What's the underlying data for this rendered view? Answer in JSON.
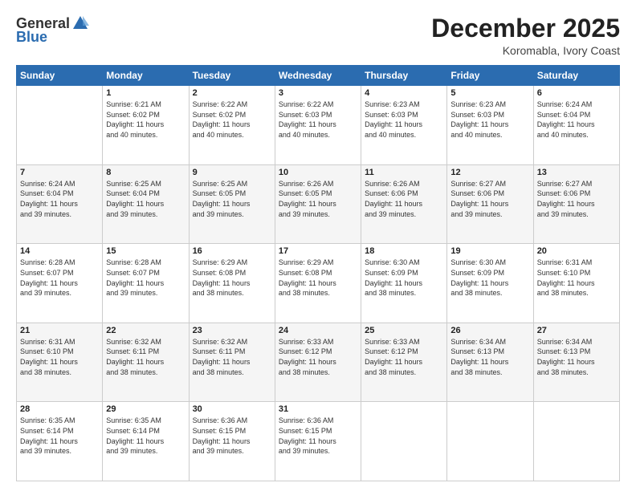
{
  "header": {
    "logo_general": "General",
    "logo_blue": "Blue",
    "month": "December 2025",
    "location": "Koromabla, Ivory Coast"
  },
  "days_of_week": [
    "Sunday",
    "Monday",
    "Tuesday",
    "Wednesday",
    "Thursday",
    "Friday",
    "Saturday"
  ],
  "weeks": [
    [
      {
        "day": "",
        "info": ""
      },
      {
        "day": "1",
        "info": "Sunrise: 6:21 AM\nSunset: 6:02 PM\nDaylight: 11 hours\nand 40 minutes."
      },
      {
        "day": "2",
        "info": "Sunrise: 6:22 AM\nSunset: 6:02 PM\nDaylight: 11 hours\nand 40 minutes."
      },
      {
        "day": "3",
        "info": "Sunrise: 6:22 AM\nSunset: 6:03 PM\nDaylight: 11 hours\nand 40 minutes."
      },
      {
        "day": "4",
        "info": "Sunrise: 6:23 AM\nSunset: 6:03 PM\nDaylight: 11 hours\nand 40 minutes."
      },
      {
        "day": "5",
        "info": "Sunrise: 6:23 AM\nSunset: 6:03 PM\nDaylight: 11 hours\nand 40 minutes."
      },
      {
        "day": "6",
        "info": "Sunrise: 6:24 AM\nSunset: 6:04 PM\nDaylight: 11 hours\nand 40 minutes."
      }
    ],
    [
      {
        "day": "7",
        "info": "Sunrise: 6:24 AM\nSunset: 6:04 PM\nDaylight: 11 hours\nand 39 minutes."
      },
      {
        "day": "8",
        "info": "Sunrise: 6:25 AM\nSunset: 6:04 PM\nDaylight: 11 hours\nand 39 minutes."
      },
      {
        "day": "9",
        "info": "Sunrise: 6:25 AM\nSunset: 6:05 PM\nDaylight: 11 hours\nand 39 minutes."
      },
      {
        "day": "10",
        "info": "Sunrise: 6:26 AM\nSunset: 6:05 PM\nDaylight: 11 hours\nand 39 minutes."
      },
      {
        "day": "11",
        "info": "Sunrise: 6:26 AM\nSunset: 6:06 PM\nDaylight: 11 hours\nand 39 minutes."
      },
      {
        "day": "12",
        "info": "Sunrise: 6:27 AM\nSunset: 6:06 PM\nDaylight: 11 hours\nand 39 minutes."
      },
      {
        "day": "13",
        "info": "Sunrise: 6:27 AM\nSunset: 6:06 PM\nDaylight: 11 hours\nand 39 minutes."
      }
    ],
    [
      {
        "day": "14",
        "info": "Sunrise: 6:28 AM\nSunset: 6:07 PM\nDaylight: 11 hours\nand 39 minutes."
      },
      {
        "day": "15",
        "info": "Sunrise: 6:28 AM\nSunset: 6:07 PM\nDaylight: 11 hours\nand 39 minutes."
      },
      {
        "day": "16",
        "info": "Sunrise: 6:29 AM\nSunset: 6:08 PM\nDaylight: 11 hours\nand 38 minutes."
      },
      {
        "day": "17",
        "info": "Sunrise: 6:29 AM\nSunset: 6:08 PM\nDaylight: 11 hours\nand 38 minutes."
      },
      {
        "day": "18",
        "info": "Sunrise: 6:30 AM\nSunset: 6:09 PM\nDaylight: 11 hours\nand 38 minutes."
      },
      {
        "day": "19",
        "info": "Sunrise: 6:30 AM\nSunset: 6:09 PM\nDaylight: 11 hours\nand 38 minutes."
      },
      {
        "day": "20",
        "info": "Sunrise: 6:31 AM\nSunset: 6:10 PM\nDaylight: 11 hours\nand 38 minutes."
      }
    ],
    [
      {
        "day": "21",
        "info": "Sunrise: 6:31 AM\nSunset: 6:10 PM\nDaylight: 11 hours\nand 38 minutes."
      },
      {
        "day": "22",
        "info": "Sunrise: 6:32 AM\nSunset: 6:11 PM\nDaylight: 11 hours\nand 38 minutes."
      },
      {
        "day": "23",
        "info": "Sunrise: 6:32 AM\nSunset: 6:11 PM\nDaylight: 11 hours\nand 38 minutes."
      },
      {
        "day": "24",
        "info": "Sunrise: 6:33 AM\nSunset: 6:12 PM\nDaylight: 11 hours\nand 38 minutes."
      },
      {
        "day": "25",
        "info": "Sunrise: 6:33 AM\nSunset: 6:12 PM\nDaylight: 11 hours\nand 38 minutes."
      },
      {
        "day": "26",
        "info": "Sunrise: 6:34 AM\nSunset: 6:13 PM\nDaylight: 11 hours\nand 38 minutes."
      },
      {
        "day": "27",
        "info": "Sunrise: 6:34 AM\nSunset: 6:13 PM\nDaylight: 11 hours\nand 38 minutes."
      }
    ],
    [
      {
        "day": "28",
        "info": "Sunrise: 6:35 AM\nSunset: 6:14 PM\nDaylight: 11 hours\nand 39 minutes."
      },
      {
        "day": "29",
        "info": "Sunrise: 6:35 AM\nSunset: 6:14 PM\nDaylight: 11 hours\nand 39 minutes."
      },
      {
        "day": "30",
        "info": "Sunrise: 6:36 AM\nSunset: 6:15 PM\nDaylight: 11 hours\nand 39 minutes."
      },
      {
        "day": "31",
        "info": "Sunrise: 6:36 AM\nSunset: 6:15 PM\nDaylight: 11 hours\nand 39 minutes."
      },
      {
        "day": "",
        "info": ""
      },
      {
        "day": "",
        "info": ""
      },
      {
        "day": "",
        "info": ""
      }
    ]
  ]
}
